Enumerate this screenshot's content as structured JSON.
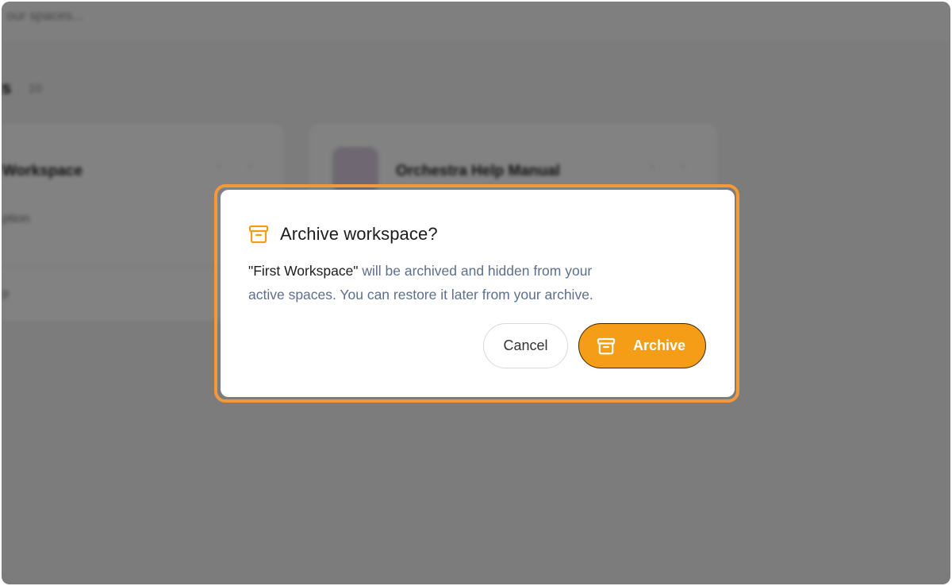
{
  "background": {
    "search_placeholder": "our spaces...",
    "section": {
      "title": "s",
      "count": "10"
    },
    "cards": [
      {
        "name": "Workspace",
        "meta": "ption",
        "footer": "p"
      },
      {
        "name": "Orchestra Help Manual"
      }
    ]
  },
  "dialog": {
    "icon": "archive-box-icon",
    "title": "Archive workspace?",
    "workspace_name": "\"First Workspace\"",
    "message_line1": " will be archived and hidden from your",
    "message_line2": "active spaces. You can restore it later from your archive.",
    "cancel_label": "Cancel",
    "archive_label": "Archive"
  },
  "colors": {
    "accent": "#f59d16",
    "highlight_border": "#f2993a",
    "body_text": "#5d6f8c",
    "overlay": "rgba(0,0,0,0.49)"
  }
}
